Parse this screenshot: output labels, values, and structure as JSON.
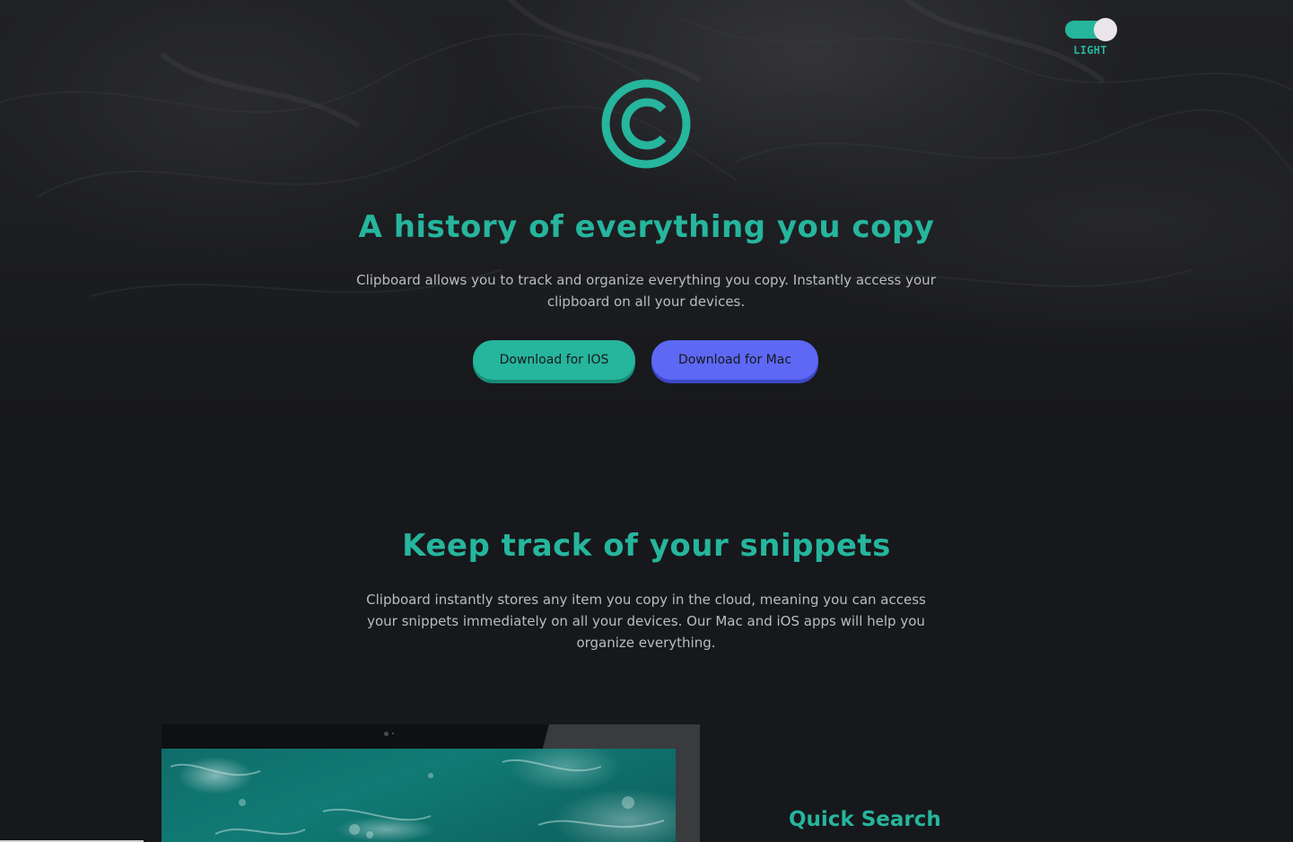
{
  "theme_toggle": {
    "label": "LIGHT",
    "state": "on"
  },
  "logo": {
    "icon": "copyright-circle-icon"
  },
  "hero": {
    "title": "A history of everything you copy",
    "description": "Clipboard allows you to track and organize everything you copy. Instantly access your clipboard on all your devices.",
    "buttons": {
      "ios_label": "Download for IOS",
      "mac_label": "Download for Mac"
    }
  },
  "snippets": {
    "title": "Keep track of your snippets",
    "description": "Clipboard instantly stores any item you copy in the cloud, meaning you can access your snippets immediately on all your devices. Our Mac and iOS apps will help you organize everything."
  },
  "features": [
    {
      "title": "Quick Search"
    }
  ],
  "colors": {
    "accent": "#26b59d",
    "secondary": "#5d68f5",
    "background": "#17181b",
    "text": "#b9bcc2"
  }
}
